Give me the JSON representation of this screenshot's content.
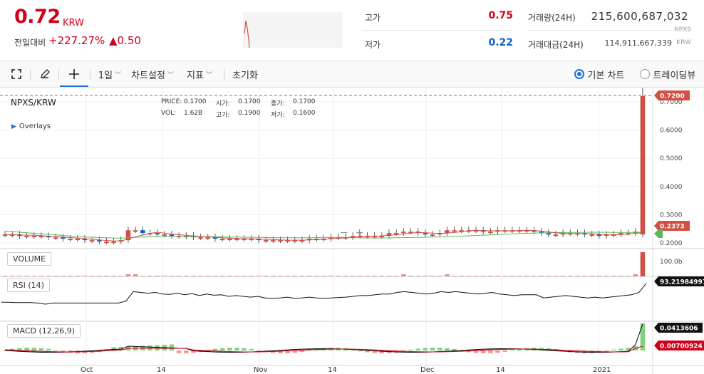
{
  "header": {
    "price": "0.72",
    "price_unit": "KRW",
    "change_label": "전일대비",
    "change_rate": "+227.27%",
    "change_amount": "▲0.50",
    "high_label": "고가",
    "high_value": "0.75",
    "low_label": "저가",
    "low_value": "0.22",
    "volume_label": "거래량(24H)",
    "volume_value": "215,600,687,032",
    "volume_unit": "NPXS",
    "amount_label": "거래대금(24H)",
    "amount_value": "114,911,667,339",
    "amount_unit": "KRW"
  },
  "toolbar": {
    "interval": "1일",
    "chart_settings": "차트설정",
    "indicators": "지표",
    "reset": "초기화",
    "basic_chart": "기본 차트",
    "trading_view": "트레이딩뷰"
  },
  "chart": {
    "symbol": "NPXS/KRW",
    "overlays": "Overlays",
    "ohlc": {
      "price_label": "PRICE:",
      "price": "0.1700",
      "open_label": "시가:",
      "open": "0.1700",
      "close_label": "종가:",
      "close": "0.1700",
      "vol_label": "VOL:",
      "vol": "1.62B",
      "high_label": "고가:",
      "high": "0.1900",
      "low_label": "저가:",
      "low": "0.1600"
    },
    "y_ticks": [
      "0.7000",
      "0.6000",
      "0.5000",
      "0.4000",
      "0.3000",
      "0.2000"
    ],
    "x_ticks": [
      "Oct",
      "14",
      "Nov",
      "14",
      "Dec",
      "14",
      "2021"
    ],
    "price_tag": "0.7200",
    "ma_tag": "0.2373",
    "volume_label": "VOLUME",
    "volume_scale": "100.0b",
    "rsi_label": "RSI (14)",
    "rsi_tag": "93.21984997",
    "rsi_scale": "20",
    "macd_label": "MACD (12,26,9)",
    "macd_tag": "0.0413606",
    "signal_tag": "0.00700924",
    "colors": {
      "up": "#d24f45",
      "down": "#1261c4",
      "ma": "#5cb85c",
      "accent": "#1e6fd9",
      "red": "#d0021b"
    }
  },
  "chart_data": {
    "type": "candlestick",
    "symbol": "NPXS/KRW",
    "x_range": [
      "Sep",
      "2021-01"
    ],
    "price_ylim": [
      0.19,
      0.72
    ],
    "price_values": [
      0.23,
      0.23,
      0.225,
      0.225,
      0.225,
      0.225,
      0.22,
      0.22,
      0.215,
      0.215,
      0.215,
      0.21,
      0.21,
      0.205,
      0.205,
      0.205,
      0.21,
      0.245,
      0.245,
      0.235,
      0.235,
      0.23,
      0.23,
      0.225,
      0.225,
      0.225,
      0.22,
      0.22,
      0.22,
      0.215,
      0.215,
      0.215,
      0.215,
      0.215,
      0.215,
      0.21,
      0.21,
      0.21,
      0.21,
      0.21,
      0.21,
      0.21,
      0.215,
      0.215,
      0.215,
      0.22,
      0.22,
      0.22,
      0.225,
      0.225,
      0.225,
      0.225,
      0.225,
      0.235,
      0.235,
      0.24,
      0.24,
      0.235,
      0.23,
      0.23,
      0.235,
      0.245,
      0.245,
      0.245,
      0.245,
      0.245,
      0.24,
      0.24,
      0.245,
      0.245,
      0.245,
      0.245,
      0.245,
      0.24,
      0.235,
      0.23,
      0.23,
      0.235,
      0.235,
      0.235,
      0.23,
      0.23,
      0.225,
      0.23,
      0.23,
      0.235,
      0.235,
      0.24,
      0.72
    ],
    "rsi_values": [
      45,
      45,
      44,
      44,
      44,
      43,
      40,
      43,
      43,
      43,
      43,
      43,
      43,
      43,
      43,
      43,
      43,
      48,
      72,
      70,
      68,
      70,
      66,
      65,
      68,
      64,
      67,
      62,
      66,
      63,
      64,
      60,
      62,
      60,
      58,
      60,
      56,
      55,
      56,
      58,
      55,
      56,
      58,
      56,
      55,
      56,
      57,
      58,
      60,
      62,
      62,
      64,
      66,
      66,
      70,
      72,
      70,
      68,
      66,
      68,
      72,
      70,
      72,
      70,
      68,
      66,
      68,
      70,
      66,
      64,
      62,
      64,
      64,
      64,
      56,
      58,
      60,
      62,
      60,
      58,
      56,
      58,
      56,
      58,
      60,
      62,
      64,
      70,
      93.2
    ],
    "volume_scale": "100.0b",
    "rsi_last": 93.21984997,
    "macd_last": 0.0413606,
    "signal_last": 0.00700924,
    "ma_last": 0.2373
  }
}
